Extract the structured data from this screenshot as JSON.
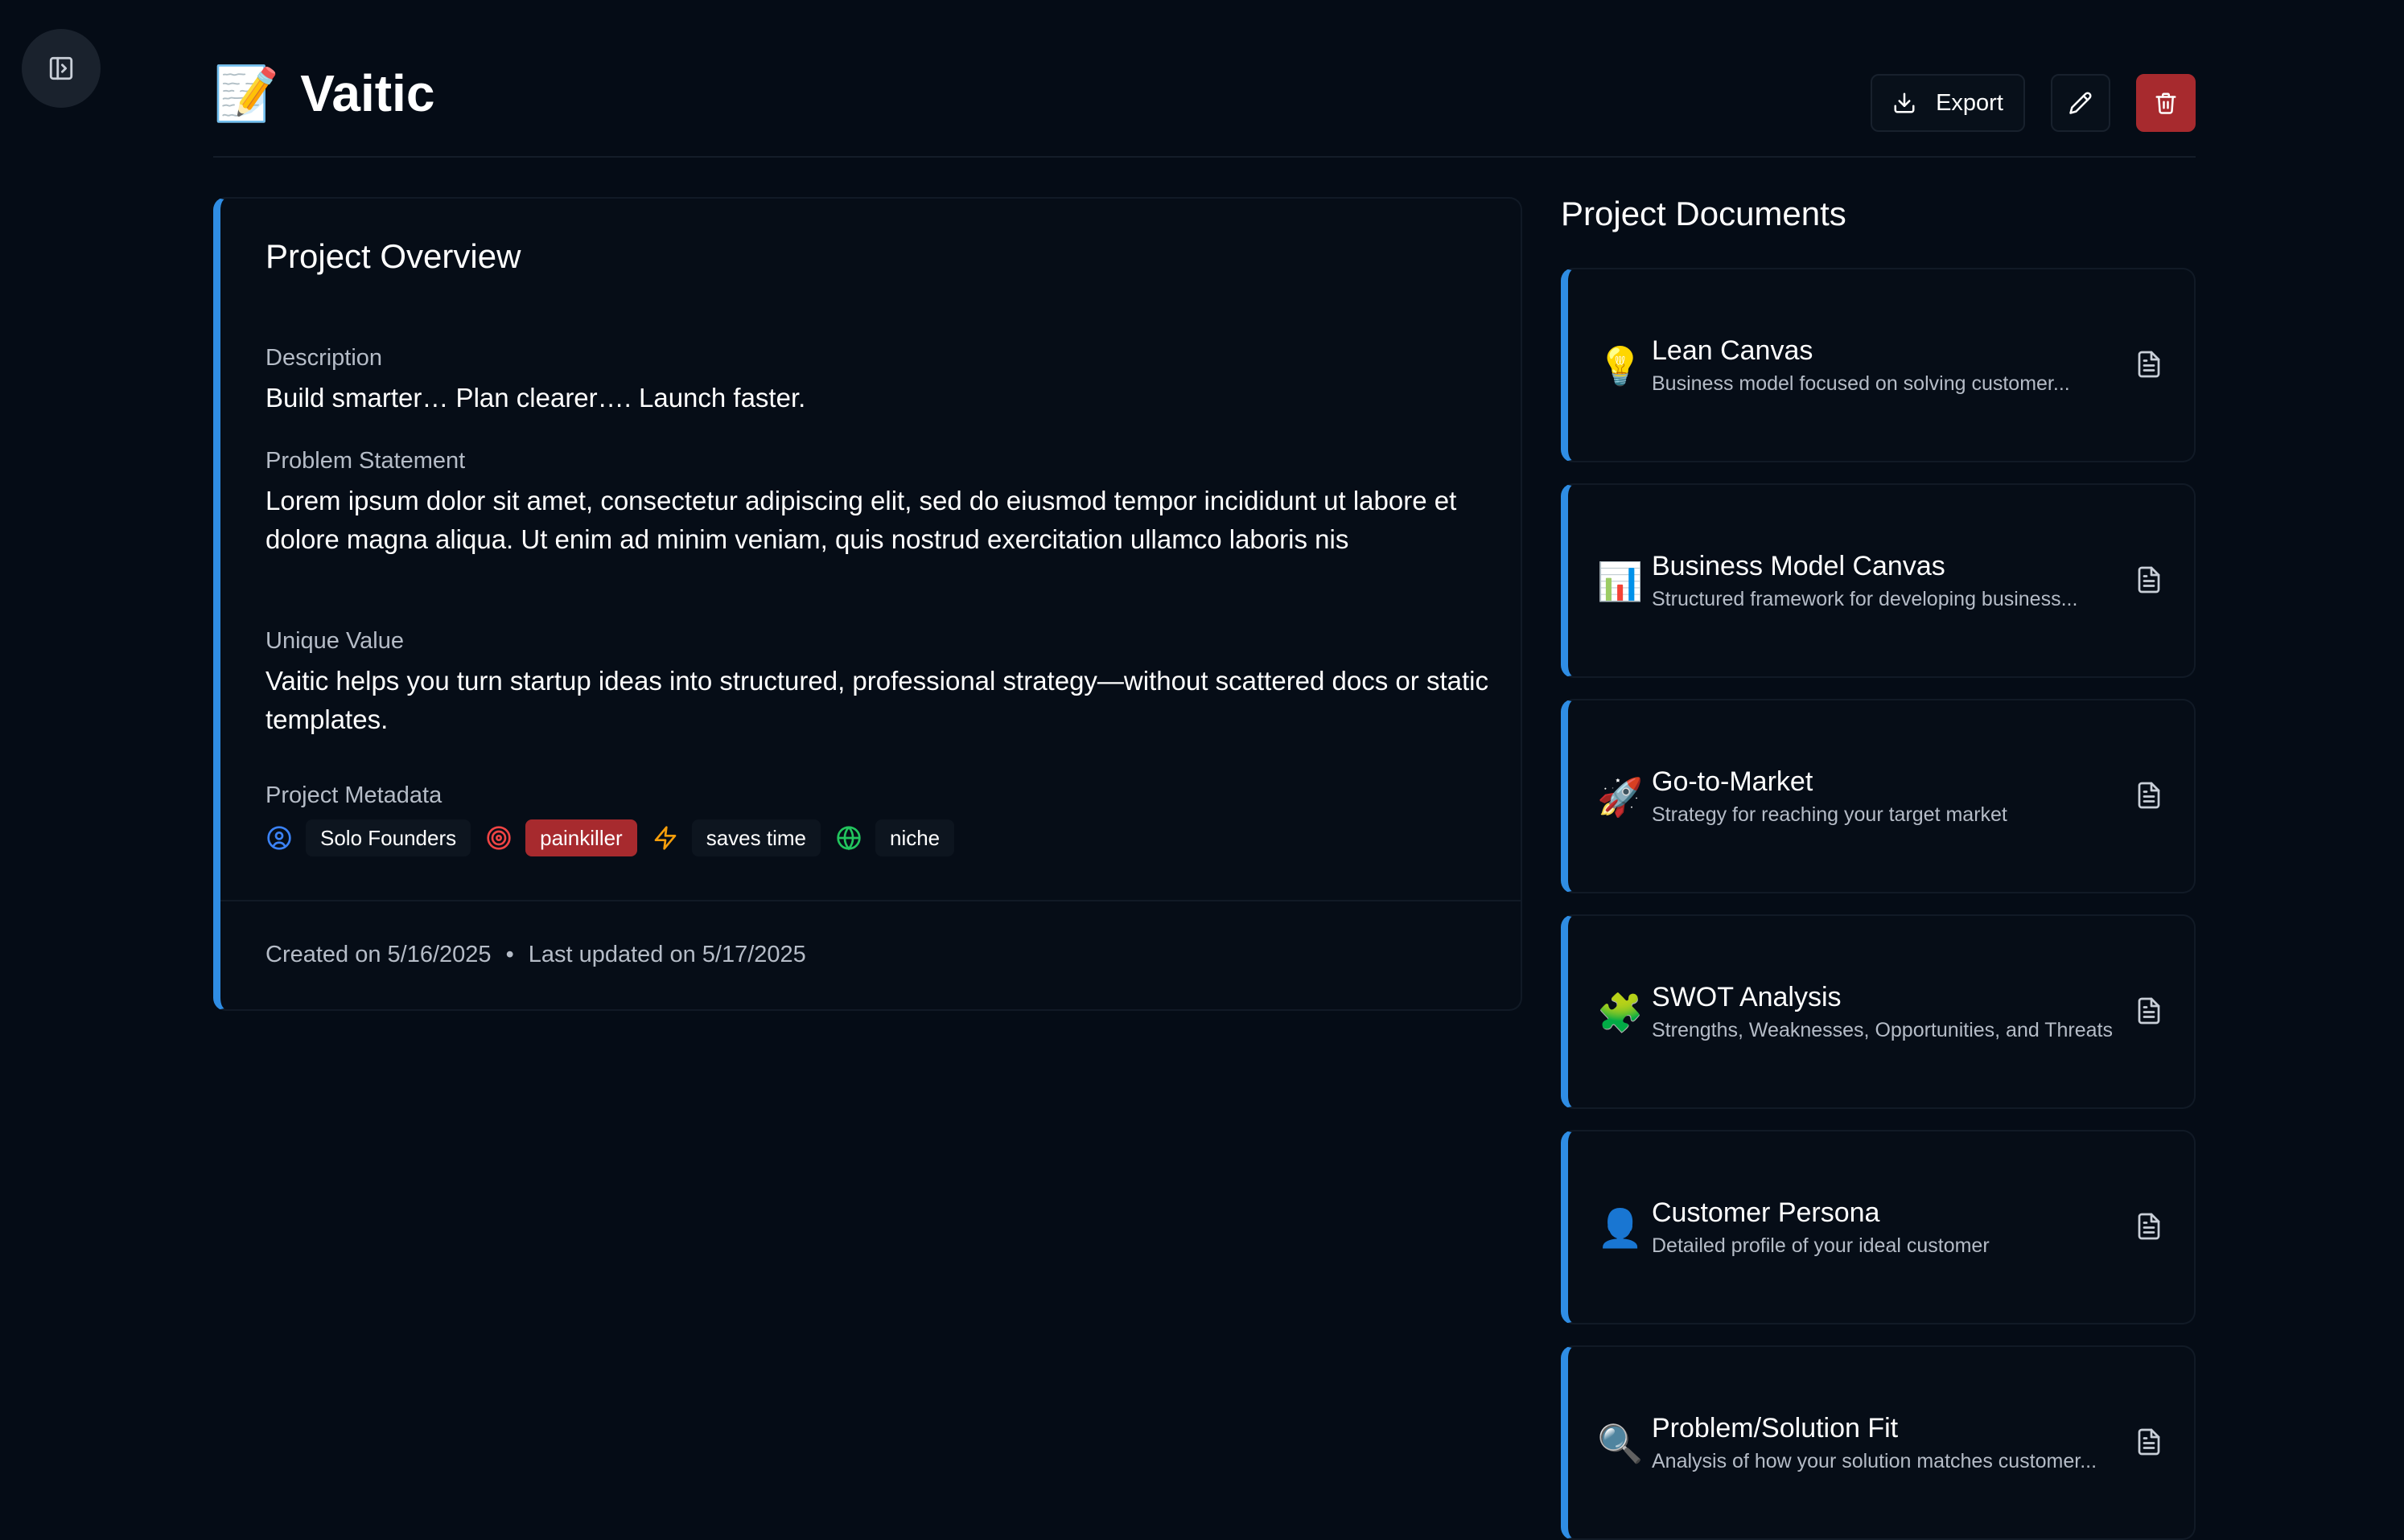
{
  "header": {
    "title_emoji": "📝",
    "title": "Vaitic",
    "export_label": "Export"
  },
  "overview": {
    "title": "Project Overview",
    "description_label": "Description",
    "description": "Build smarter… Plan clearer…. Launch faster.",
    "problem_label": "Problem Statement",
    "problem": "Lorem ipsum dolor sit amet, consectetur adipiscing elit, sed do eiusmod tempor incididunt ut labore et dolore magna aliqua. Ut enim ad minim veniam, quis nostrud exercitation ullamco laboris nis",
    "unique_label": "Unique Value",
    "unique": "Vaitic helps you turn startup ideas into structured, professional strategy—without scattered docs or static templates.",
    "metadata_label": "Project Metadata",
    "tags": {
      "audience": "Solo Founders",
      "pain": "painkiller",
      "benefit": "saves time",
      "market": "niche"
    },
    "created": "Created on 5/16/2025",
    "separator": "•",
    "updated": "Last updated on 5/17/2025"
  },
  "documents": {
    "title": "Project Documents",
    "items": [
      {
        "emoji": "💡",
        "name": "Lean Canvas",
        "desc": "Business model focused on solving customer..."
      },
      {
        "emoji": "📊",
        "name": "Business Model Canvas",
        "desc": "Structured framework for developing business..."
      },
      {
        "emoji": "🚀",
        "name": "Go-to-Market",
        "desc": "Strategy for reaching your target market"
      },
      {
        "emoji": "🧩",
        "name": "SWOT Analysis",
        "desc": "Strengths, Weaknesses, Opportunities, and Threats"
      },
      {
        "emoji": "👤",
        "name": "Customer Persona",
        "desc": "Detailed profile of your ideal customer"
      },
      {
        "emoji": "🔍",
        "name": "Problem/Solution Fit",
        "desc": "Analysis of how your solution matches customer..."
      }
    ]
  },
  "colors": {
    "background": "#050c16",
    "accent": "#2f8de4",
    "danger": "#a72a2e"
  }
}
